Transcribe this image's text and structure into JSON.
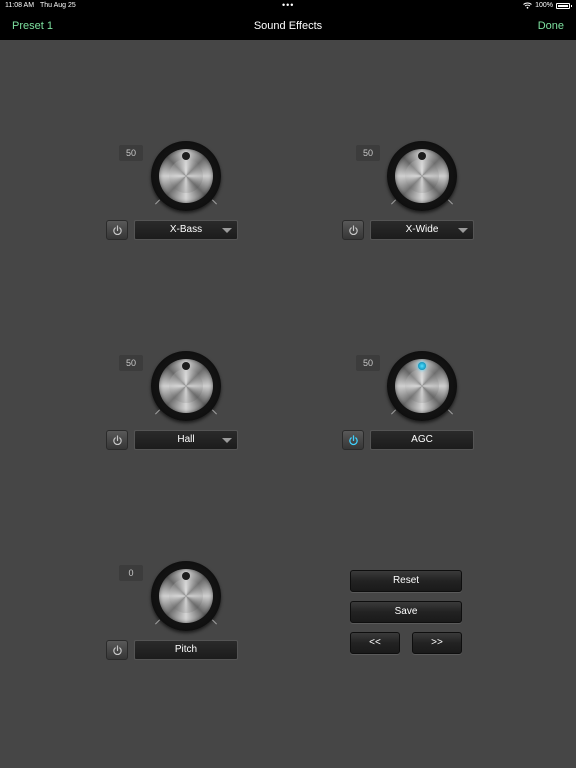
{
  "status_bar": {
    "time": "11:08 AM",
    "date": "Thu Aug 25",
    "dots": "•••",
    "battery": "100%"
  },
  "nav": {
    "left": "Preset 1",
    "title": "Sound Effects",
    "right": "Done"
  },
  "accent_color": "#7ee2a0",
  "active_color": "#3fd2ff",
  "effects": [
    {
      "value": "50",
      "label": "X-Bass",
      "has_dropdown": true,
      "enabled": false
    },
    {
      "value": "50",
      "label": "X-Wide",
      "has_dropdown": true,
      "enabled": false
    },
    {
      "value": "50",
      "label": "Hall",
      "has_dropdown": true,
      "enabled": false
    },
    {
      "value": "50",
      "label": "AGC",
      "has_dropdown": false,
      "enabled": true
    },
    {
      "value": "0",
      "label": "Pitch",
      "has_dropdown": false,
      "enabled": false
    }
  ],
  "buttons": {
    "reset": "Reset",
    "save": "Save",
    "prev": "<<",
    "next": ">>"
  },
  "icons": {
    "power": "power-icon",
    "wifi": "wifi-icon",
    "battery": "battery-icon",
    "dropdown": "chevron-down-icon"
  }
}
